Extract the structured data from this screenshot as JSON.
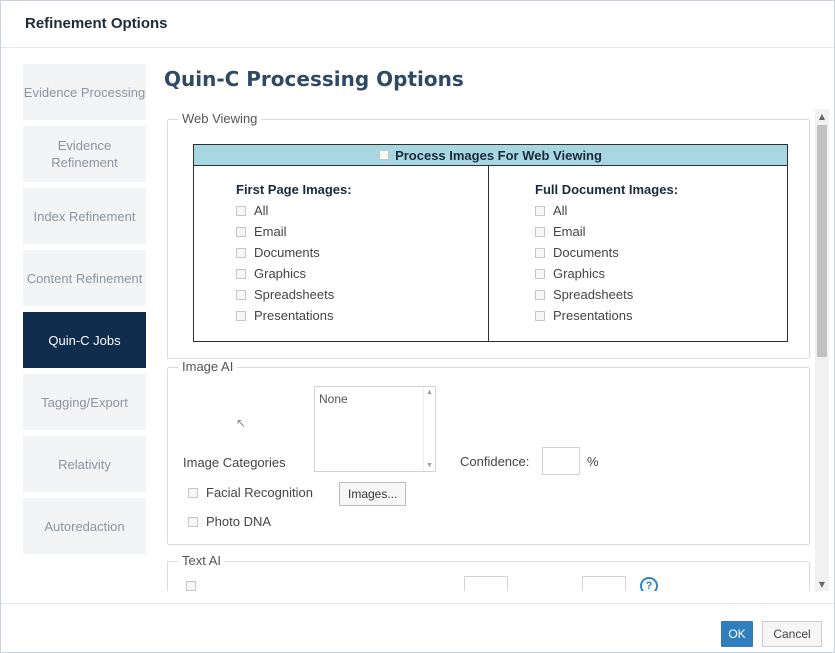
{
  "dialog": {
    "title": "Refinement Options"
  },
  "sidebar": {
    "items": [
      {
        "label": "Evidence Processing",
        "active": false
      },
      {
        "label": "Evidence Refinement",
        "active": false
      },
      {
        "label": "Index Refinement",
        "active": false
      },
      {
        "label": "Content Refinement",
        "active": false
      },
      {
        "label": "Quin-C Jobs",
        "active": true
      },
      {
        "label": "Tagging/Export",
        "active": false
      },
      {
        "label": "Relativity",
        "active": false
      },
      {
        "label": "Autoredaction",
        "active": false
      }
    ]
  },
  "main": {
    "title": "Quin-C Processing Options",
    "web_viewing": {
      "legend": "Web Viewing",
      "process_label": "Process Images For Web Viewing",
      "first_page": {
        "title": "First Page Images:",
        "options": [
          "All",
          "Email",
          "Documents",
          "Graphics",
          "Spreadsheets",
          "Presentations"
        ]
      },
      "full_document": {
        "title": "Full Document Images:",
        "options": [
          "All",
          "Email",
          "Documents",
          "Graphics",
          "Spreadsheets",
          "Presentations"
        ]
      }
    },
    "image_ai": {
      "legend": "Image AI",
      "categories_label": "Image Categories",
      "categories_selected": "None",
      "confidence_label": "Confidence:",
      "confidence_unit": "%",
      "facial_recognition_label": "Facial Recognition",
      "images_button": "Images...",
      "photo_dna_label": "Photo DNA"
    },
    "text_ai": {
      "legend": "Text AI"
    }
  },
  "footer": {
    "ok": "OK",
    "cancel": "Cancel"
  },
  "colors": {
    "active_nav": "#0f2c4c",
    "header_bar": "#a8d7e2",
    "ok_button": "#2f7fbf"
  },
  "icons": {
    "help": "help-circle-icon"
  }
}
